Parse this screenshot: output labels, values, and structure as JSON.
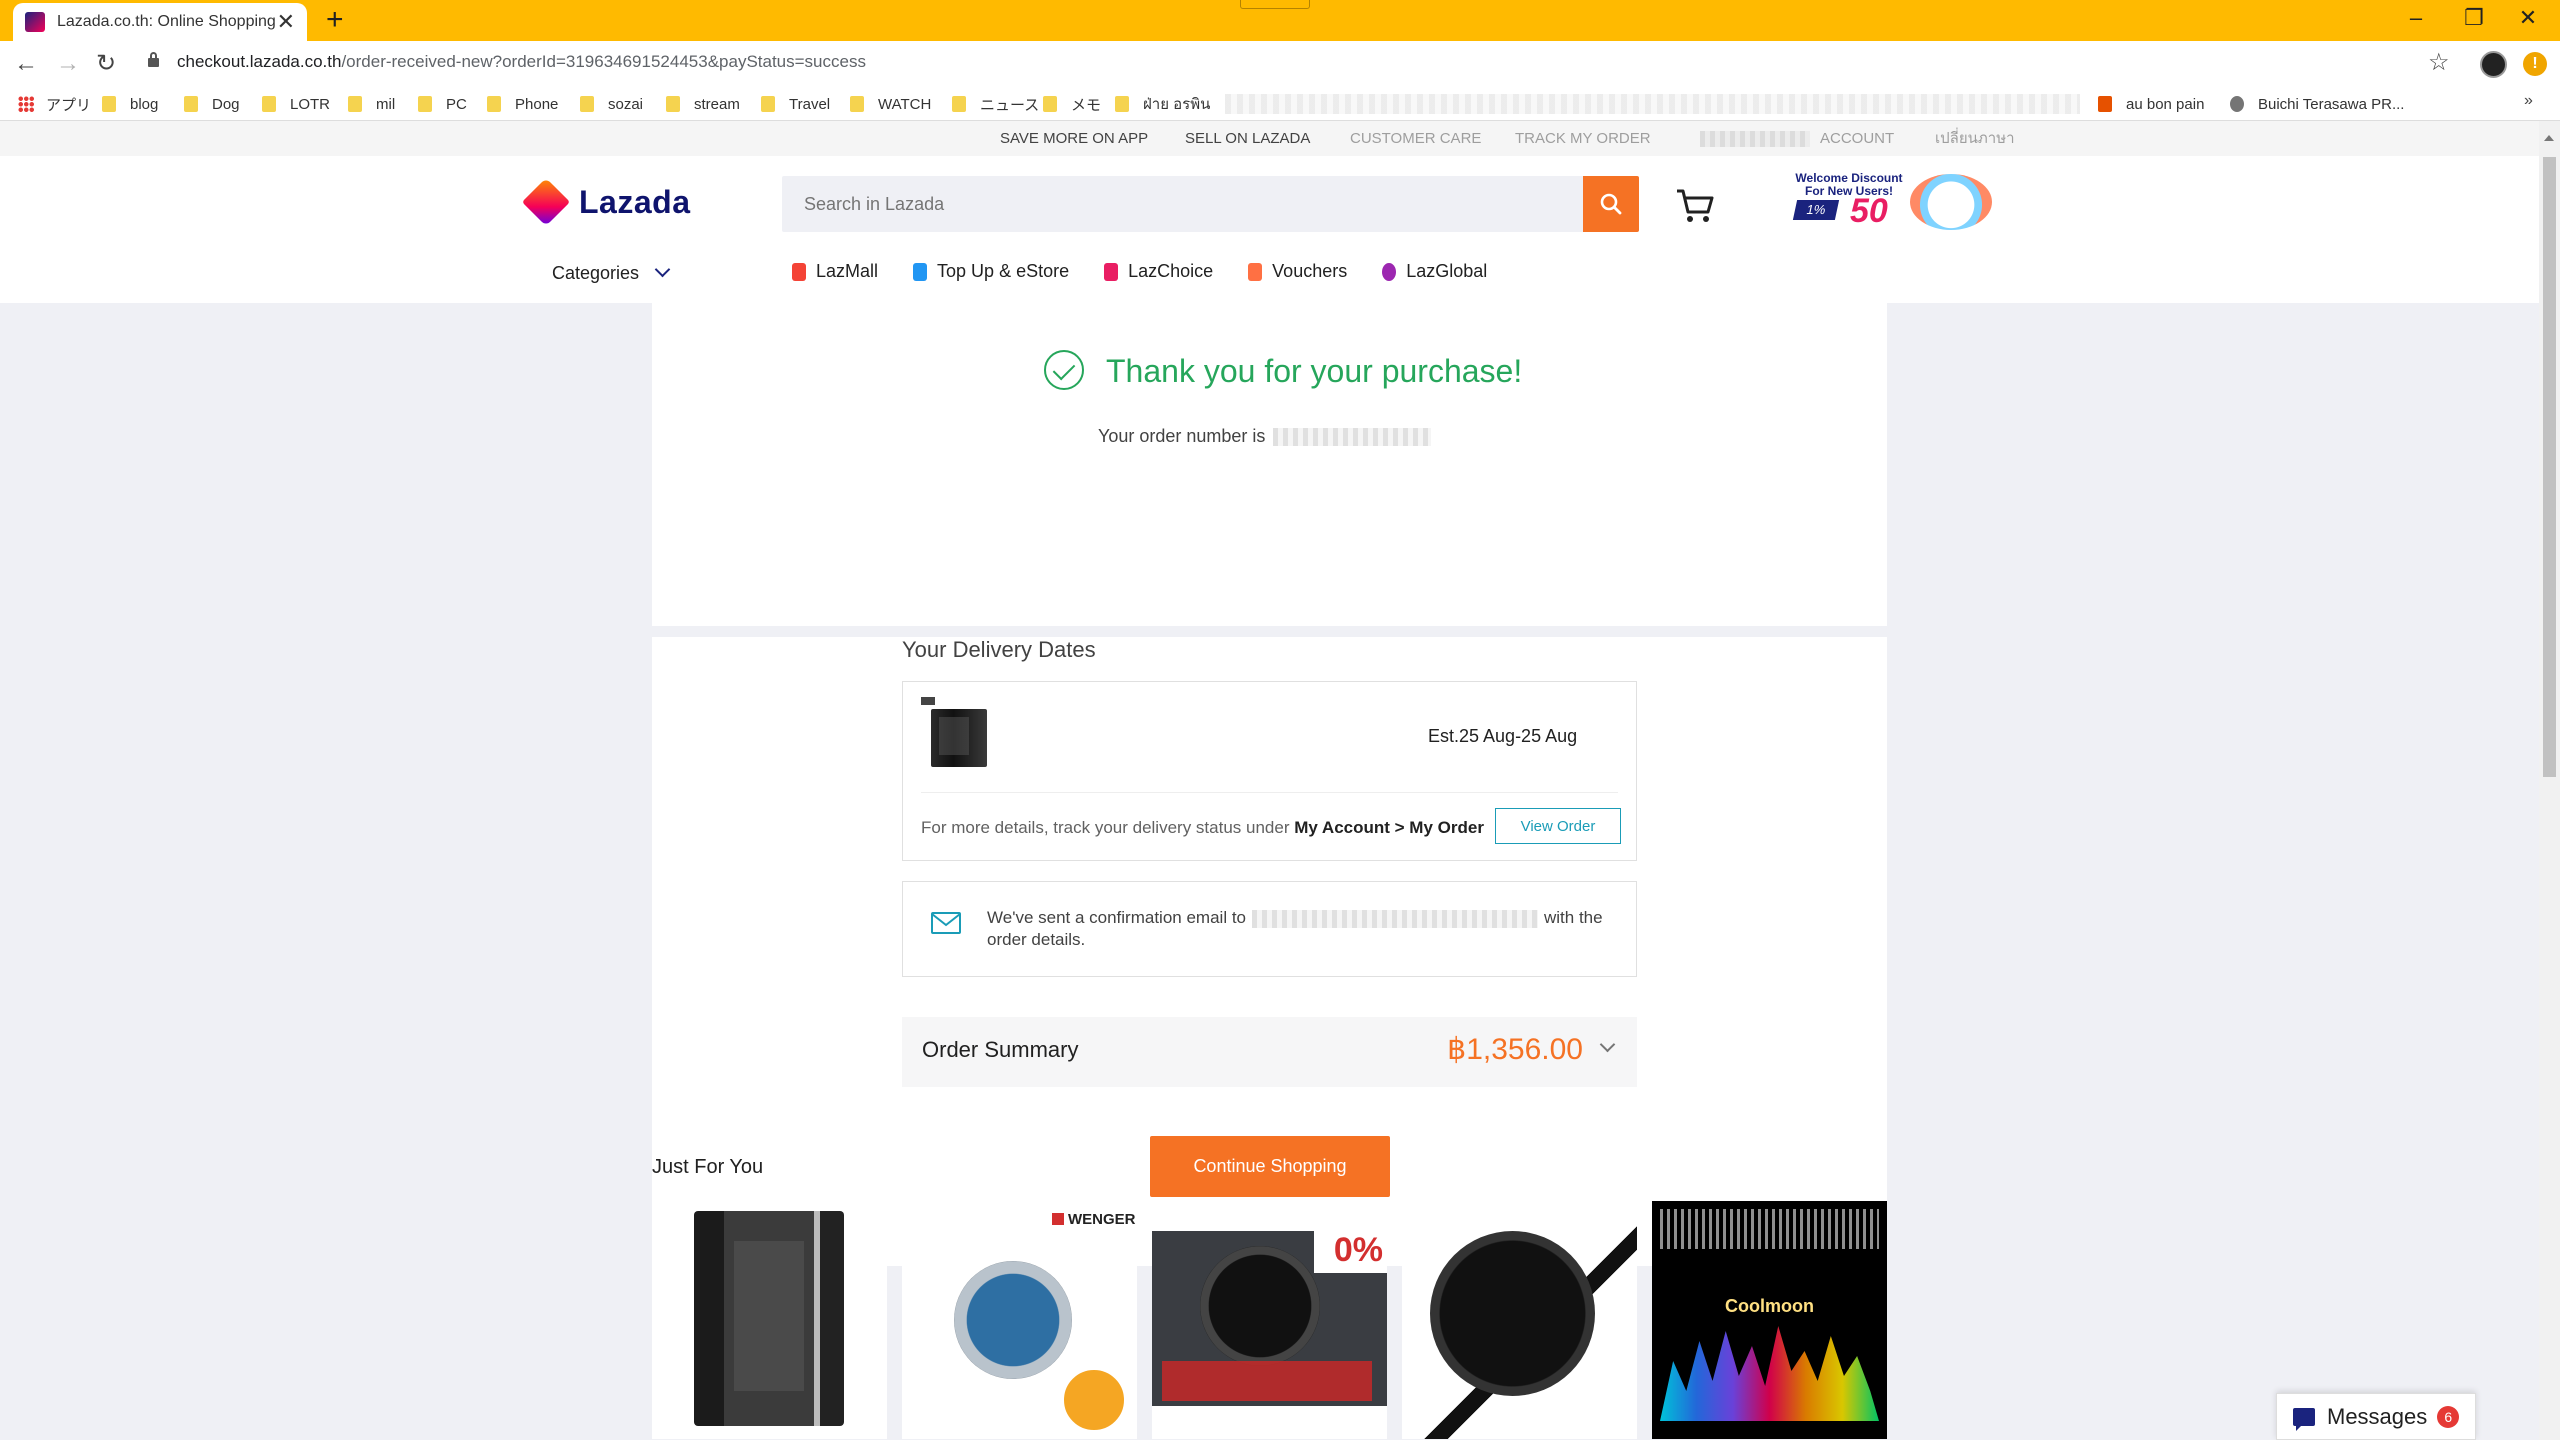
{
  "browser": {
    "tab_title": "Lazada.co.th: Online Shopping Th",
    "new_tab_symbol": "+",
    "close_symbol": "✕",
    "url_host": "checkout.lazada.co.th",
    "url_path": "/order-received-new?orderId=319634691524453&payStatus=success",
    "update_label": "!",
    "bookmarks": [
      "アプリ",
      "blog",
      "Dog",
      "LOTR",
      "mil",
      "PC",
      "Phone",
      "sozai",
      "stream",
      "Travel",
      "WATCH",
      "ニュース",
      "メモ",
      "ฝ่าย อรพิน",
      "au bon pain",
      "Buichi Terasawa PR..."
    ]
  },
  "topbar": {
    "links": [
      "SAVE MORE ON APP",
      "SELL ON LAZADA",
      "CUSTOMER CARE",
      "TRACK MY ORDER",
      "ACCOUNT",
      "เปลี่ยนภาษา"
    ]
  },
  "header": {
    "logo_text": "Lazada",
    "search_placeholder": "Search in Lazada",
    "promo_text": "Welcome Discount For New Users!",
    "promo_value": "50",
    "promo_prefix": "1%",
    "categories_label": "Categories",
    "nav_links": [
      {
        "label": "LazMall",
        "color": "#f44336"
      },
      {
        "label": "Top Up & eStore",
        "color": "#2196f3"
      },
      {
        "label": "LazChoice",
        "color": "#e91e63"
      },
      {
        "label": "Vouchers",
        "color": "#ff7043"
      },
      {
        "label": "LazGlobal",
        "color": "#9c27b0"
      }
    ]
  },
  "confirmation": {
    "title": "Thank you for your purchase!",
    "order_number_label": "Your order number is"
  },
  "delivery": {
    "section_title": "Your Delivery Dates",
    "estimate": "Est.25 Aug-25 Aug",
    "track_prefix": "For more details, track your delivery status under",
    "track_link": "My Account > My Order",
    "view_order_label": "View Order"
  },
  "email": {
    "prefix": "We've sent a confirmation email to",
    "suffix": "with the order details."
  },
  "summary": {
    "label": "Order Summary",
    "amount": "฿1,356.00"
  },
  "continue_label": "Continue Shopping",
  "just_for_you": {
    "title": "Just For You",
    "items": [
      {
        "brand": ""
      },
      {
        "brand": "WENGER"
      },
      {
        "tag": "0%"
      },
      {
        "brand": ""
      },
      {
        "title": "Coolmoon"
      }
    ]
  },
  "messages": {
    "label": "Messages",
    "count": "6"
  }
}
